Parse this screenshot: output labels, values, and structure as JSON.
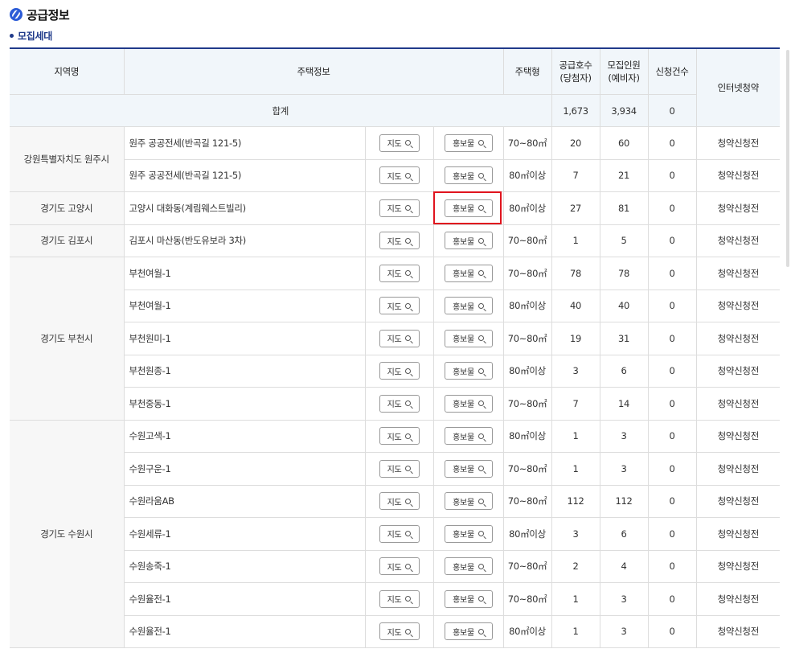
{
  "page": {
    "title": "공급정보",
    "subtitle": "모집세대"
  },
  "headers": {
    "region": "지역명",
    "housing": "주택정보",
    "type": "주택형",
    "supply_l1": "공급호수",
    "supply_l2": "(당첨자)",
    "recruit_l1": "모집인원",
    "recruit_l2": "(예비자)",
    "applications": "신청건수",
    "internet": "인터넷청약"
  },
  "summary": {
    "label": "합계",
    "supply": "1,673",
    "recruit": "3,934",
    "applications": "0"
  },
  "labels": {
    "map": "지도",
    "promo": "홍보물"
  },
  "highlight_color": "#e0141e",
  "regions": [
    {
      "name": "강원특별자치도 원주시",
      "rows": [
        {
          "name": "원주 공공전세(반곡길 121-5)",
          "type": "70~80㎡",
          "supply": "20",
          "recruit": "60",
          "apps": "0",
          "status": "청약신청전"
        },
        {
          "name": "원주 공공전세(반곡길 121-5)",
          "type": "80㎡이상",
          "supply": "7",
          "recruit": "21",
          "apps": "0",
          "status": "청약신청전"
        }
      ]
    },
    {
      "name": "경기도 고양시",
      "rows": [
        {
          "name": "고양시 대화동(계림웨스트빌리)",
          "type": "80㎡이상",
          "supply": "27",
          "recruit": "81",
          "apps": "0",
          "status": "청약신청전"
        }
      ]
    },
    {
      "name": "경기도 김포시",
      "rows": [
        {
          "name": "김포시 마산동(반도유보라 3차)",
          "type": "70~80㎡",
          "supply": "1",
          "recruit": "5",
          "apps": "0",
          "status": "청약신청전"
        }
      ]
    },
    {
      "name": "경기도 부천시",
      "rows": [
        {
          "name": "부천여월-1",
          "type": "70~80㎡",
          "supply": "78",
          "recruit": "78",
          "apps": "0",
          "status": "청약신청전"
        },
        {
          "name": "부천여월-1",
          "type": "80㎡이상",
          "supply": "40",
          "recruit": "40",
          "apps": "0",
          "status": "청약신청전"
        },
        {
          "name": "부천원미-1",
          "type": "70~80㎡",
          "supply": "19",
          "recruit": "31",
          "apps": "0",
          "status": "청약신청전"
        },
        {
          "name": "부천원종-1",
          "type": "80㎡이상",
          "supply": "3",
          "recruit": "6",
          "apps": "0",
          "status": "청약신청전"
        },
        {
          "name": "부천중동-1",
          "type": "70~80㎡",
          "supply": "7",
          "recruit": "14",
          "apps": "0",
          "status": "청약신청전"
        }
      ]
    },
    {
      "name": "경기도 수원시",
      "rows": [
        {
          "name": "수원고색-1",
          "type": "80㎡이상",
          "supply": "1",
          "recruit": "3",
          "apps": "0",
          "status": "청약신청전"
        },
        {
          "name": "수원구운-1",
          "type": "70~80㎡",
          "supply": "1",
          "recruit": "3",
          "apps": "0",
          "status": "청약신청전"
        },
        {
          "name": "수원라움AB",
          "type": "70~80㎡",
          "supply": "112",
          "recruit": "112",
          "apps": "0",
          "status": "청약신청전"
        },
        {
          "name": "수원세류-1",
          "type": "80㎡이상",
          "supply": "3",
          "recruit": "6",
          "apps": "0",
          "status": "청약신청전"
        },
        {
          "name": "수원송죽-1",
          "type": "70~80㎡",
          "supply": "2",
          "recruit": "4",
          "apps": "0",
          "status": "청약신청전"
        },
        {
          "name": "수원율전-1",
          "type": "70~80㎡",
          "supply": "1",
          "recruit": "3",
          "apps": "0",
          "status": "청약신청전"
        },
        {
          "name": "수원율전-1",
          "type": "80㎡이상",
          "supply": "1",
          "recruit": "3",
          "apps": "0",
          "status": "청약신청전"
        }
      ]
    }
  ]
}
